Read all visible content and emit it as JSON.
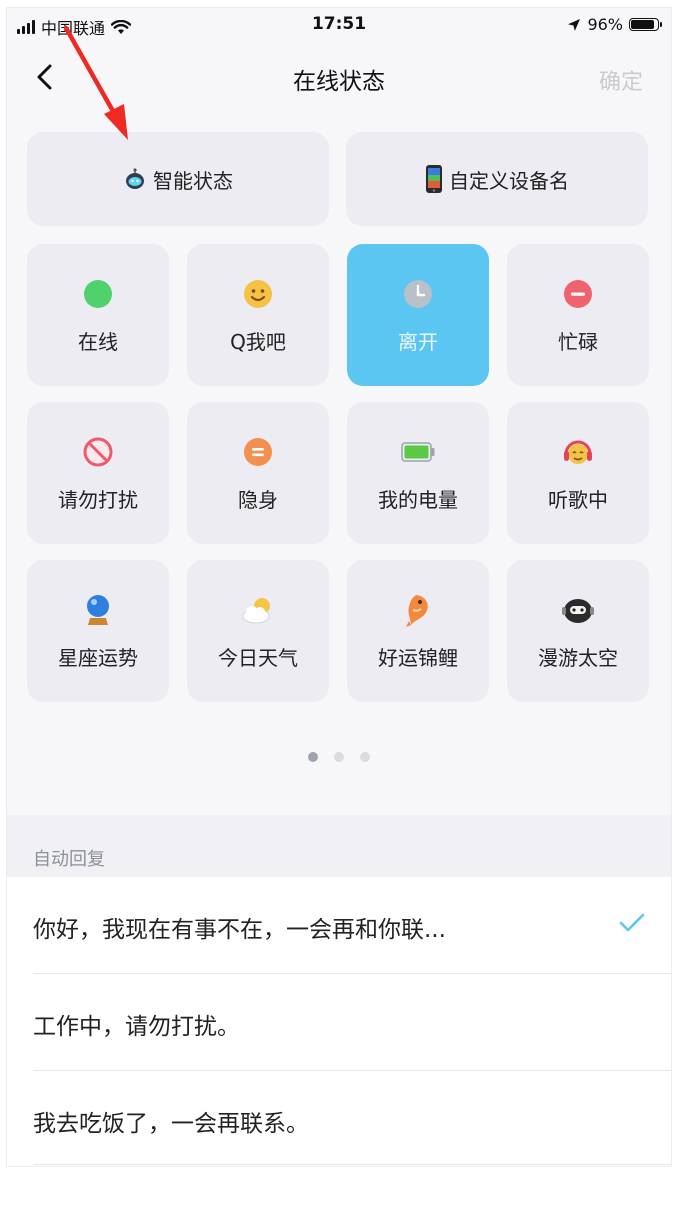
{
  "status_bar": {
    "carrier": "中国联通",
    "time": "17:51",
    "battery": "96%",
    "battery_level": 0.96
  },
  "nav": {
    "title": "在线状态",
    "confirm": "确定"
  },
  "top_buttons": [
    {
      "label": "智能状态",
      "icon": "robot-icon"
    },
    {
      "label": "自定义设备名",
      "icon": "phone-icon"
    }
  ],
  "statuses": [
    {
      "label": "在线",
      "icon": "green-dot-icon"
    },
    {
      "label": "Q我吧",
      "icon": "smiley-icon"
    },
    {
      "label": "离开",
      "icon": "clock-icon",
      "selected": true
    },
    {
      "label": "忙碌",
      "icon": "minus-circle-icon"
    },
    {
      "label": "请勿打扰",
      "icon": "no-entry-icon"
    },
    {
      "label": "隐身",
      "icon": "equals-circle-icon"
    },
    {
      "label": "我的电量",
      "icon": "battery-icon"
    },
    {
      "label": "听歌中",
      "icon": "headphones-face-icon"
    },
    {
      "label": "星座运势",
      "icon": "crystal-ball-icon"
    },
    {
      "label": "今日天气",
      "icon": "cloud-sun-icon"
    },
    {
      "label": "好运锦鲤",
      "icon": "koi-fish-icon"
    },
    {
      "label": "漫游太空",
      "icon": "astronaut-icon"
    }
  ],
  "pager": {
    "pages": 3,
    "current": 1
  },
  "auto_reply": {
    "header": "自动回复",
    "items": [
      {
        "text": "你好，我现在有事不在，一会再和你联...",
        "selected": true
      },
      {
        "text": "工作中，请勿打扰。",
        "selected": false
      },
      {
        "text": "我去吃饭了，一会再联系。",
        "selected": false
      }
    ]
  },
  "colors": {
    "accent": "#5bc6f2",
    "tile_bg": "#ececf2",
    "annotation_arrow": "#ee2a22"
  }
}
